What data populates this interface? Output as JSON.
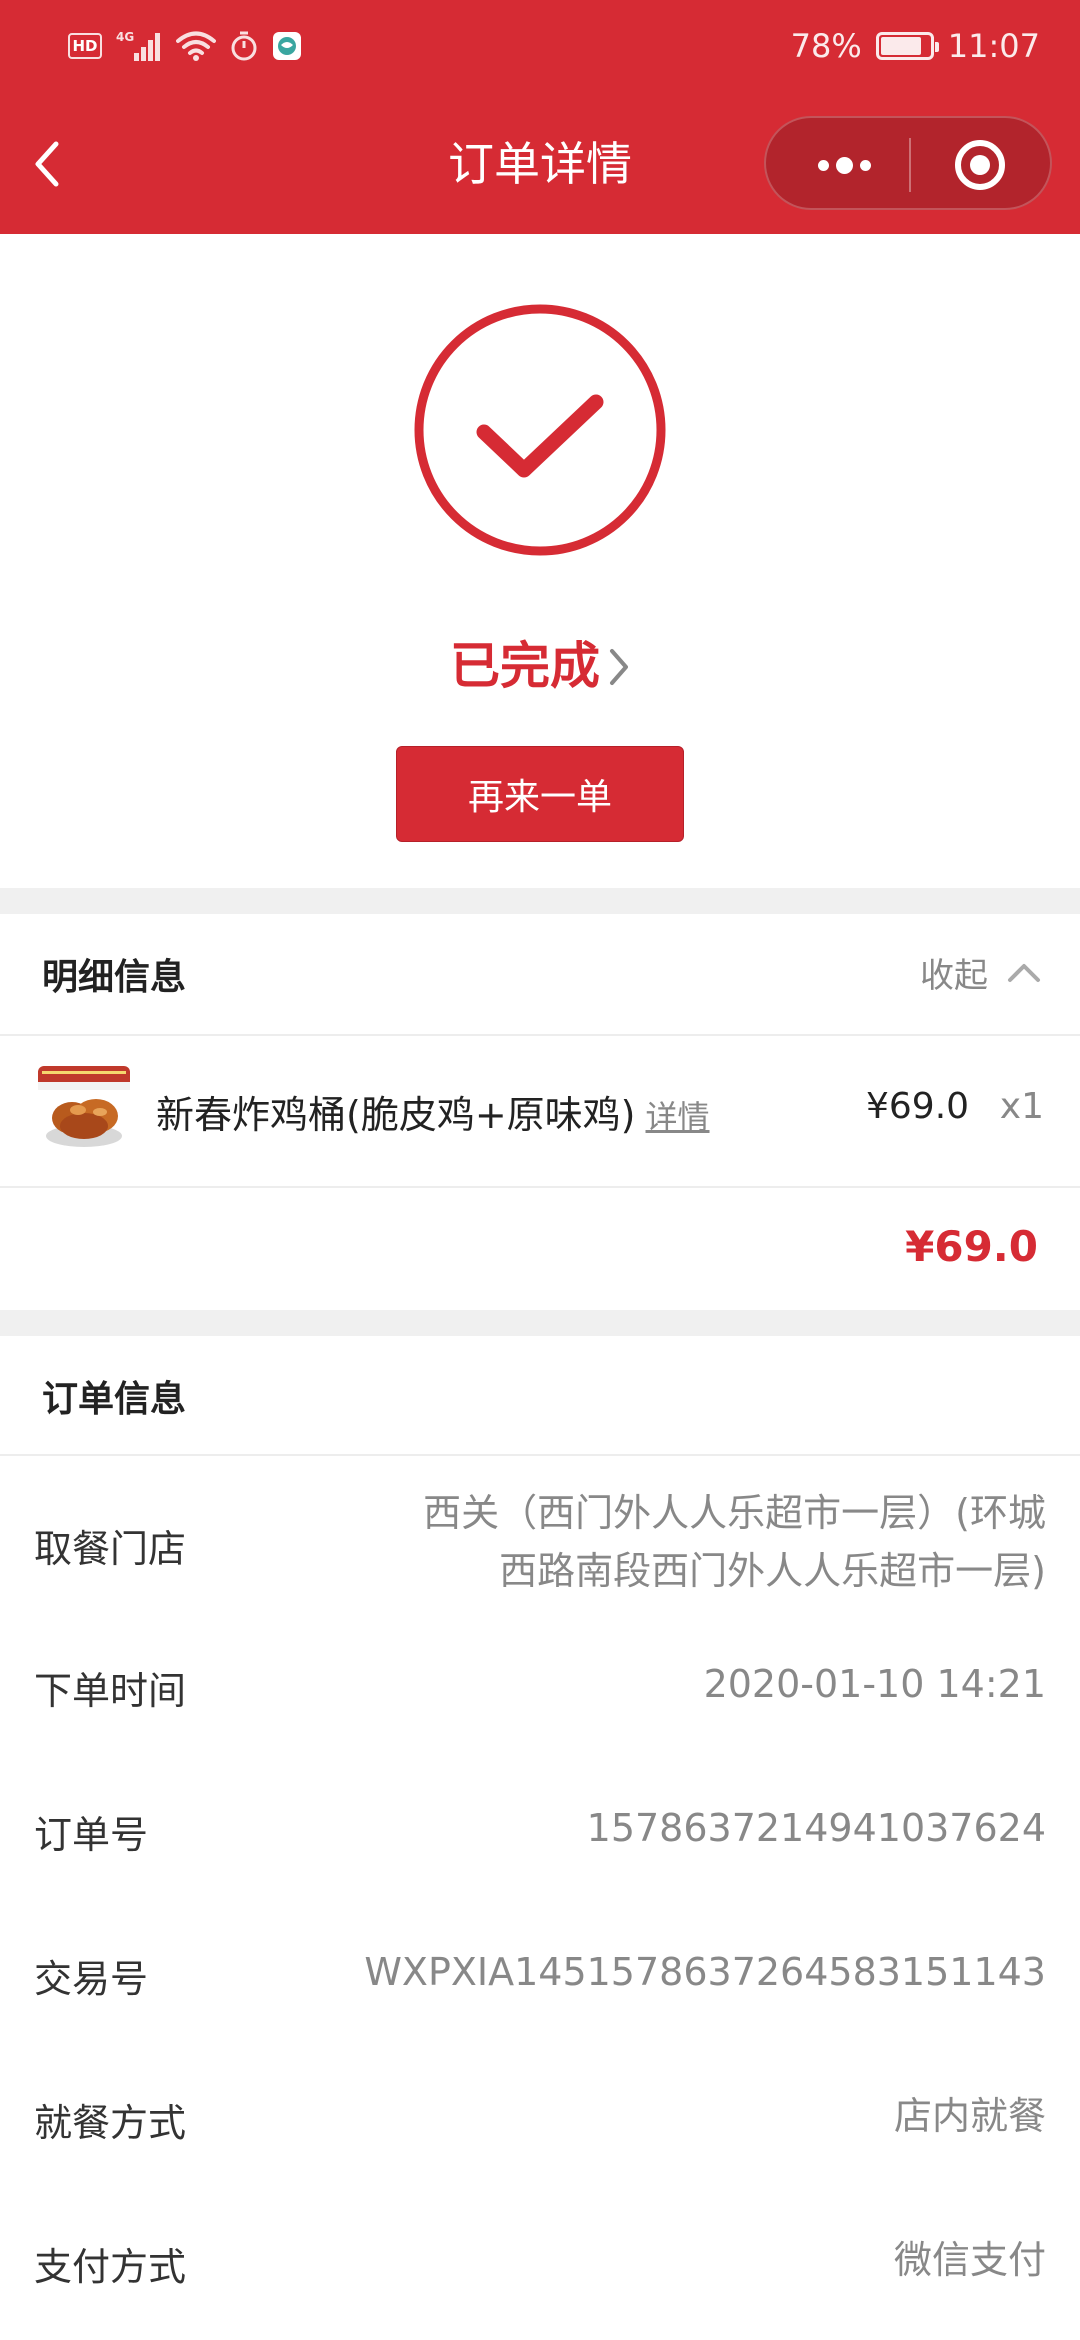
{
  "status_bar": {
    "left_icons": [
      "hd-icon",
      "signal-4g-icon",
      "wifi-icon",
      "timer-icon",
      "app-notification-icon"
    ],
    "network": "4G",
    "battery_percent": "78%",
    "battery_level": 0.78,
    "time": "11:07"
  },
  "nav": {
    "title": "订单详情",
    "back_icon": "chevron-left-icon",
    "more_icon": "more-dots-icon",
    "close_icon": "target-close-icon"
  },
  "order_status": {
    "icon": "check-circle-icon",
    "label": "已完成",
    "reorder_label": "再来一单"
  },
  "details": {
    "title": "明细信息",
    "collapse_label": "收起",
    "items": [
      {
        "name": "新春炸鸡桶(脆皮鸡+原味鸡)",
        "detail_link": "详情",
        "price": "¥69.0",
        "quantity": "x1"
      }
    ],
    "total": "¥69.0"
  },
  "order_info": {
    "title": "订单信息",
    "rows": [
      {
        "label": "取餐门店",
        "value_line1": "西关（西门外人人乐超市一层）(环城",
        "value_line2": "西路南段西门外人人乐超市一层)"
      },
      {
        "label": "下单时间",
        "value": "2020-01-10 14:21"
      },
      {
        "label": "订单号",
        "value": "1578637214941037624"
      },
      {
        "label": "交易号",
        "value": "WXPXIA1451578637264583151143"
      },
      {
        "label": "就餐方式",
        "value": "店内就餐"
      },
      {
        "label": "支付方式",
        "value": "微信支付"
      }
    ]
  },
  "colors": {
    "brand_red": "#d62b34",
    "capsule_bg": "#b2242c",
    "separator": "#f0f0f0",
    "muted_text": "#888888"
  }
}
